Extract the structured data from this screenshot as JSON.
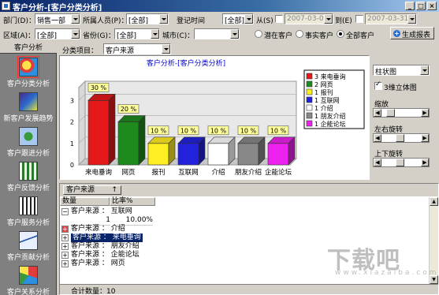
{
  "window": {
    "title": "客户分析-[客户分类分析]"
  },
  "filters": {
    "dept_label": "部门(D)：",
    "dept_value": "销售一部",
    "staff_label": "所属人员(P)：",
    "staff_value": "[全部]",
    "regtime_label": "登记时间",
    "regtime_value": "[全部]",
    "from_label": "从(S)",
    "from_value": "2007-03-01",
    "to_label": "到(E)",
    "to_value": "2007-03-31",
    "region_label": "区域(A)：",
    "region_value": "[全部]",
    "province_label": "省份(G)：",
    "province_value": "[全部]",
    "city_label": "城市(C)：",
    "city_value": "",
    "radio_potential": "潜在客户",
    "radio_actual": "事实客户",
    "radio_all": "全部客户",
    "generate_button": "生成报表"
  },
  "sidebar": {
    "header": "客户分析",
    "items": [
      {
        "label": "客户分类分析",
        "icon": "pie-chart-icon"
      },
      {
        "label": "新客户发展趋势",
        "icon": "trend-chart-icon"
      },
      {
        "label": "客户跟进分析",
        "icon": "follow-chart-icon"
      },
      {
        "label": "客户反馈分析",
        "icon": "feedback-chart-icon"
      },
      {
        "label": "客户服务分析",
        "icon": "service-chart-icon"
      },
      {
        "label": "客户贡献分析",
        "icon": "contribution-chart-icon"
      },
      {
        "label": "客户关系分析",
        "icon": "relation-chart-icon"
      }
    ]
  },
  "category": {
    "label": "分类项目：",
    "value": "客户来源"
  },
  "chart_data": {
    "type": "bar",
    "title": "客户分析-[客户分类分析]",
    "categories": [
      "来电垂询",
      "网页",
      "报刊",
      "互联网",
      "介绍",
      "朋友介绍",
      "企能论坛"
    ],
    "values": [
      3,
      2,
      1,
      1,
      1,
      1,
      1
    ],
    "data_labels": [
      "30 %",
      "20 %",
      "10 %",
      "10 %",
      "10 %",
      "10 %",
      "10 %"
    ],
    "colors": [
      "#e41a1a",
      "#1e8a1e",
      "#ffee22",
      "#2222dd",
      "#ffffff",
      "#888888",
      "#ee22ee"
    ],
    "yticks": [
      "0",
      "1",
      "2",
      "3"
    ],
    "ylim": [
      0,
      3.6
    ],
    "grid": true,
    "legend": [
      "3 来电垂询",
      "2 网页",
      "1 报刊",
      "1 互联网",
      "1 介绍",
      "1 朋友介绍",
      "1 企能论坛"
    ],
    "legend_position": "top-right"
  },
  "options": {
    "chart_type": "柱状图",
    "threed_label": "3维立体图",
    "threed_checked": true,
    "zoom_label": "缩放",
    "lr_label": "左右旋转",
    "ud_label": "上下旋转",
    "zoom_level": 0.15,
    "lr_level": 0.45,
    "ud_level": 0.45
  },
  "grid": {
    "group_label": "客户来源",
    "col_count": "数量",
    "col_ratio": "比率%",
    "rows": [
      {
        "exp": "−",
        "text": "客户来源 ： 互联网",
        "selected": false
      },
      {
        "exp": "",
        "text": "",
        "count": "1",
        "ratio": "10.00%",
        "detail": true
      },
      {
        "exp": "+",
        "text": "客户来源 ： 介绍",
        "selected": false,
        "flag": true
      },
      {
        "exp": "+",
        "text": "客户来源 ： 来电垂询",
        "selected": true
      },
      {
        "exp": "+",
        "text": "客户来源 ： 朋友介绍",
        "selected": false
      },
      {
        "exp": "+",
        "text": "客户来源 ： 企能论坛",
        "selected": false
      },
      {
        "exp": "+",
        "text": "客户来源 ： 网页",
        "selected": false
      }
    ],
    "footer": "合计数量：10"
  },
  "watermark": {
    "text": "下载吧",
    "sub": "www.xiazaiba.com"
  }
}
